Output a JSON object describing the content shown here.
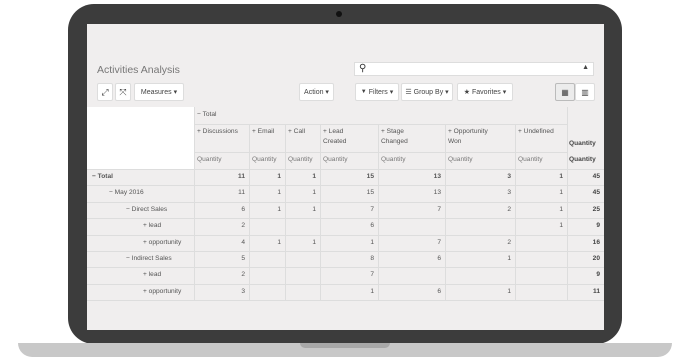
{
  "app": {
    "title": "Activities Analysis",
    "search_placeholder": ""
  },
  "toolbar": {
    "measures_label": "Measures ▾",
    "action_label": "Action ▾",
    "filters_label": "Filters ▾",
    "groupby_label": "Group By ▾",
    "favorites_label": "Favorites ▾",
    "icons": {
      "expand": "⤢",
      "flip": "⤧",
      "filters": "▼",
      "groupby": "☰",
      "favorites": "★",
      "pivot_view": "▦",
      "graph_view": "📊"
    }
  },
  "pivot": {
    "top_header": "− Total",
    "columns": [
      {
        "label": "+ Discussions",
        "sub": "Quantity"
      },
      {
        "label": "+ Email",
        "sub": "Quantity"
      },
      {
        "label": "+ Call",
        "sub": "Quantity"
      },
      {
        "label": "+ Lead\nCreated",
        "sub": "Quantity"
      },
      {
        "label": "+ Stage\nChanged",
        "sub": "Quantity"
      },
      {
        "label": "+ Opportunity\nWon",
        "sub": "Quantity"
      },
      {
        "label": "+ Undefined",
        "sub": "Quantity"
      }
    ],
    "total_col_label": "Quantity",
    "total_col_sub": "Quantity",
    "rows": [
      {
        "label": "− Total",
        "indent": 0,
        "values": [
          "11",
          "1",
          "1",
          "15",
          "13",
          "3",
          "1"
        ],
        "total": "45",
        "bold": true
      },
      {
        "label": "− May 2016",
        "indent": 1,
        "values": [
          "11",
          "1",
          "1",
          "15",
          "13",
          "3",
          "1"
        ],
        "total": "45",
        "bold": false
      },
      {
        "label": "− Direct Sales",
        "indent": 2,
        "values": [
          "6",
          "1",
          "1",
          "7",
          "7",
          "2",
          "1"
        ],
        "total": "25",
        "bold": false
      },
      {
        "label": "+ lead",
        "indent": 3,
        "values": [
          "2",
          "",
          "",
          "6",
          "",
          "",
          "1"
        ],
        "total": "9",
        "bold": false
      },
      {
        "label": "+ opportunity",
        "indent": 3,
        "values": [
          "4",
          "1",
          "1",
          "1",
          "7",
          "2",
          ""
        ],
        "total": "16",
        "bold": false
      },
      {
        "label": "− Indirect Sales",
        "indent": 2,
        "values": [
          "5",
          "",
          "",
          "8",
          "6",
          "1",
          ""
        ],
        "total": "20",
        "bold": false
      },
      {
        "label": "+ lead",
        "indent": 3,
        "values": [
          "2",
          "",
          "",
          "7",
          "",
          "",
          ""
        ],
        "total": "9",
        "bold": false
      },
      {
        "label": "+ opportunity",
        "indent": 3,
        "values": [
          "3",
          "",
          "",
          "1",
          "6",
          "1",
          ""
        ],
        "total": "11",
        "bold": false
      }
    ]
  }
}
